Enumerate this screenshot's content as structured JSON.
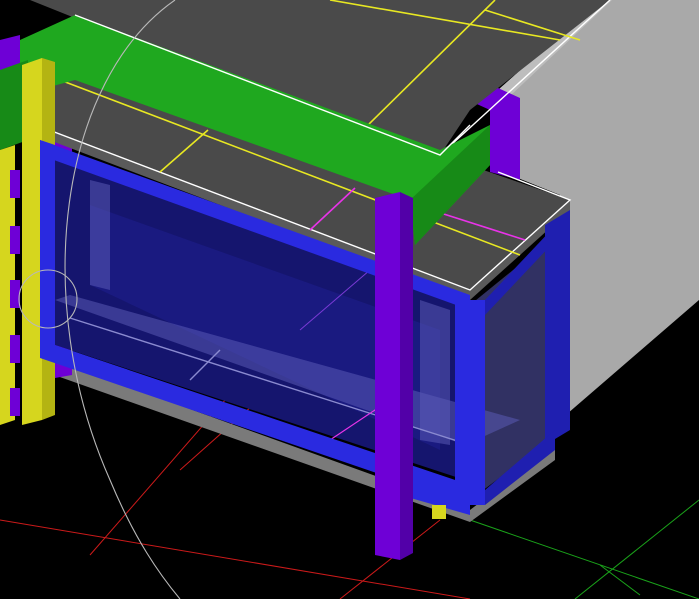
{
  "viewport": {
    "background": "#000000",
    "camera": "perspective"
  },
  "palette": {
    "roof_dark": "#4a4a4a",
    "roof_light": "#4d4d4d",
    "wall_gray": "#a9a9a9",
    "beam_green": "#1fa81f",
    "beam_green_dark": "#178a17",
    "column_purple": "#6e00d6",
    "column_purple_dark": "#5200a8",
    "column_yellow": "#d6d61e",
    "frame_blue": "#2a2ae0",
    "frame_blue_dark": "#1f1fb0",
    "glass_navy": "#15156e",
    "glass_translucent": "#5a5ab4",
    "slab_gray": "#7a7a7a",
    "line_yellow": "#e8e822",
    "line_magenta": "#e833e8",
    "line_white": "#ffffff",
    "axis_red": "#cc1a1a",
    "axis_green": "#1aa21a",
    "circle_gray": "#b8b8b8"
  },
  "scene_objects": [
    "roof-slab",
    "gray-wall-block",
    "green-beam",
    "purple-column-front",
    "purple-column-back",
    "yellow-column-left",
    "blue-window-frame",
    "glass-panel",
    "floor-slab",
    "red-grid-lines",
    "green-axis-lines",
    "orbit-circle",
    "pick-circle"
  ]
}
